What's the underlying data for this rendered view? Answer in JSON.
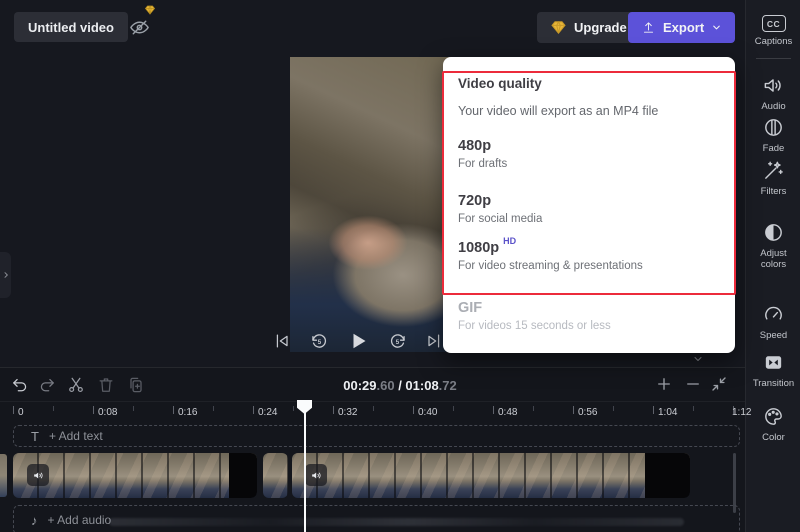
{
  "topbar": {
    "title": "Untitled video",
    "upgrade_label": "Upgrade",
    "export_label": "Export"
  },
  "sidebar": {
    "cc_glyph": "CC",
    "items": [
      {
        "label": "Captions"
      },
      {
        "label": "Audio"
      },
      {
        "label": "Fade"
      },
      {
        "label": "Filters"
      },
      {
        "label": "Adjust colors"
      },
      {
        "label": "Speed"
      },
      {
        "label": "Transition"
      },
      {
        "label": "Color"
      }
    ]
  },
  "export_popup": {
    "title": "Video quality",
    "subtitle": "Your video will export as an MP4 file",
    "options": [
      {
        "name": "480p",
        "desc": "For drafts",
        "badge": ""
      },
      {
        "name": "720p",
        "desc": "For social media",
        "badge": ""
      },
      {
        "name": "1080p",
        "desc": "For video streaming & presentations",
        "badge": "HD"
      },
      {
        "name": "GIF",
        "desc": "For videos 15 seconds or less",
        "badge": ""
      }
    ]
  },
  "timeline": {
    "current_time": "00:29",
    "current_fraction": ".60",
    "separator": " / ",
    "total_time": "01:08",
    "total_fraction": ".72",
    "ruler": [
      "0",
      "0:08",
      "0:16",
      "0:24",
      "0:32",
      "0:40",
      "0:48",
      "0:56",
      "1:04",
      "1:12"
    ],
    "add_text_label": "+ Add text",
    "add_audio_label": "+ Add audio",
    "text_track_glyph": "T",
    "audio_track_glyph": "♪"
  },
  "colors": {
    "accent_purple": "#5c52d9",
    "annotation_red": "#ec2b3b",
    "gem_gold": "#e8b63a",
    "hd_badge_purple": "#5b52c9"
  }
}
